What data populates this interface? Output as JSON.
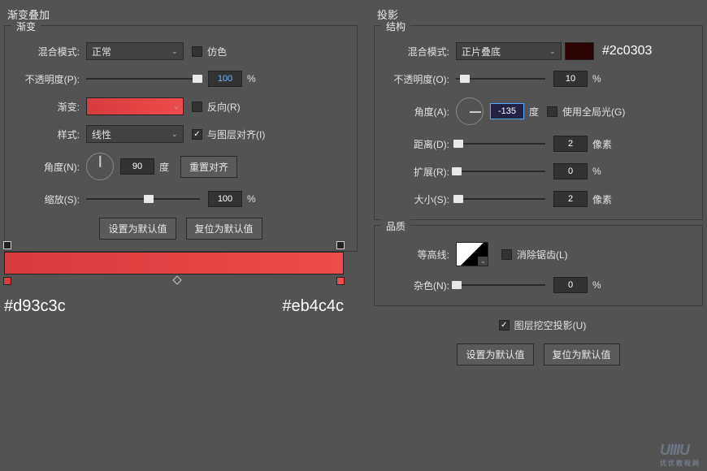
{
  "left": {
    "title": "渐变叠加",
    "group": "渐变",
    "blend_mode_label": "混合模式:",
    "blend_mode": "正常",
    "dither_label": "仿色",
    "opacity_label": "不透明度(P):",
    "opacity": "100",
    "percent": "%",
    "gradient_label": "渐变:",
    "reverse_label": "反向(R)",
    "style_label": "样式:",
    "style": "线性",
    "align_label": "与图层对齐(I)",
    "angle_label": "角度(N):",
    "angle": "90",
    "degree": "度",
    "reset_align": "重置对齐",
    "scale_label": "缩放(S):",
    "scale": "100",
    "btn_default": "设置为默认值",
    "btn_reset": "复位为默认值",
    "color1": "#d93c3c",
    "color2": "#eb4c4c"
  },
  "right": {
    "title": "投影",
    "group1": "结构",
    "blend_mode_label": "混合模式:",
    "blend_mode": "正片叠底",
    "color_annot": "#2c0303",
    "opacity_label": "不透明度(O):",
    "opacity": "10",
    "percent": "%",
    "angle_label": "角度(A):",
    "angle": "-135",
    "degree": "度",
    "global_label": "使用全局光(G)",
    "distance_label": "距离(D):",
    "distance": "2",
    "px": "像素",
    "spread_label": "扩展(R):",
    "spread": "0",
    "size_label": "大小(S):",
    "size": "2",
    "group2": "品质",
    "contour_label": "等高线:",
    "aa_label": "消除锯齿(L)",
    "noise_label": "杂色(N):",
    "noise": "0",
    "knockout_label": "图层挖空投影(U)",
    "btn_default": "设置为默认值",
    "btn_reset": "复位为默认值"
  }
}
